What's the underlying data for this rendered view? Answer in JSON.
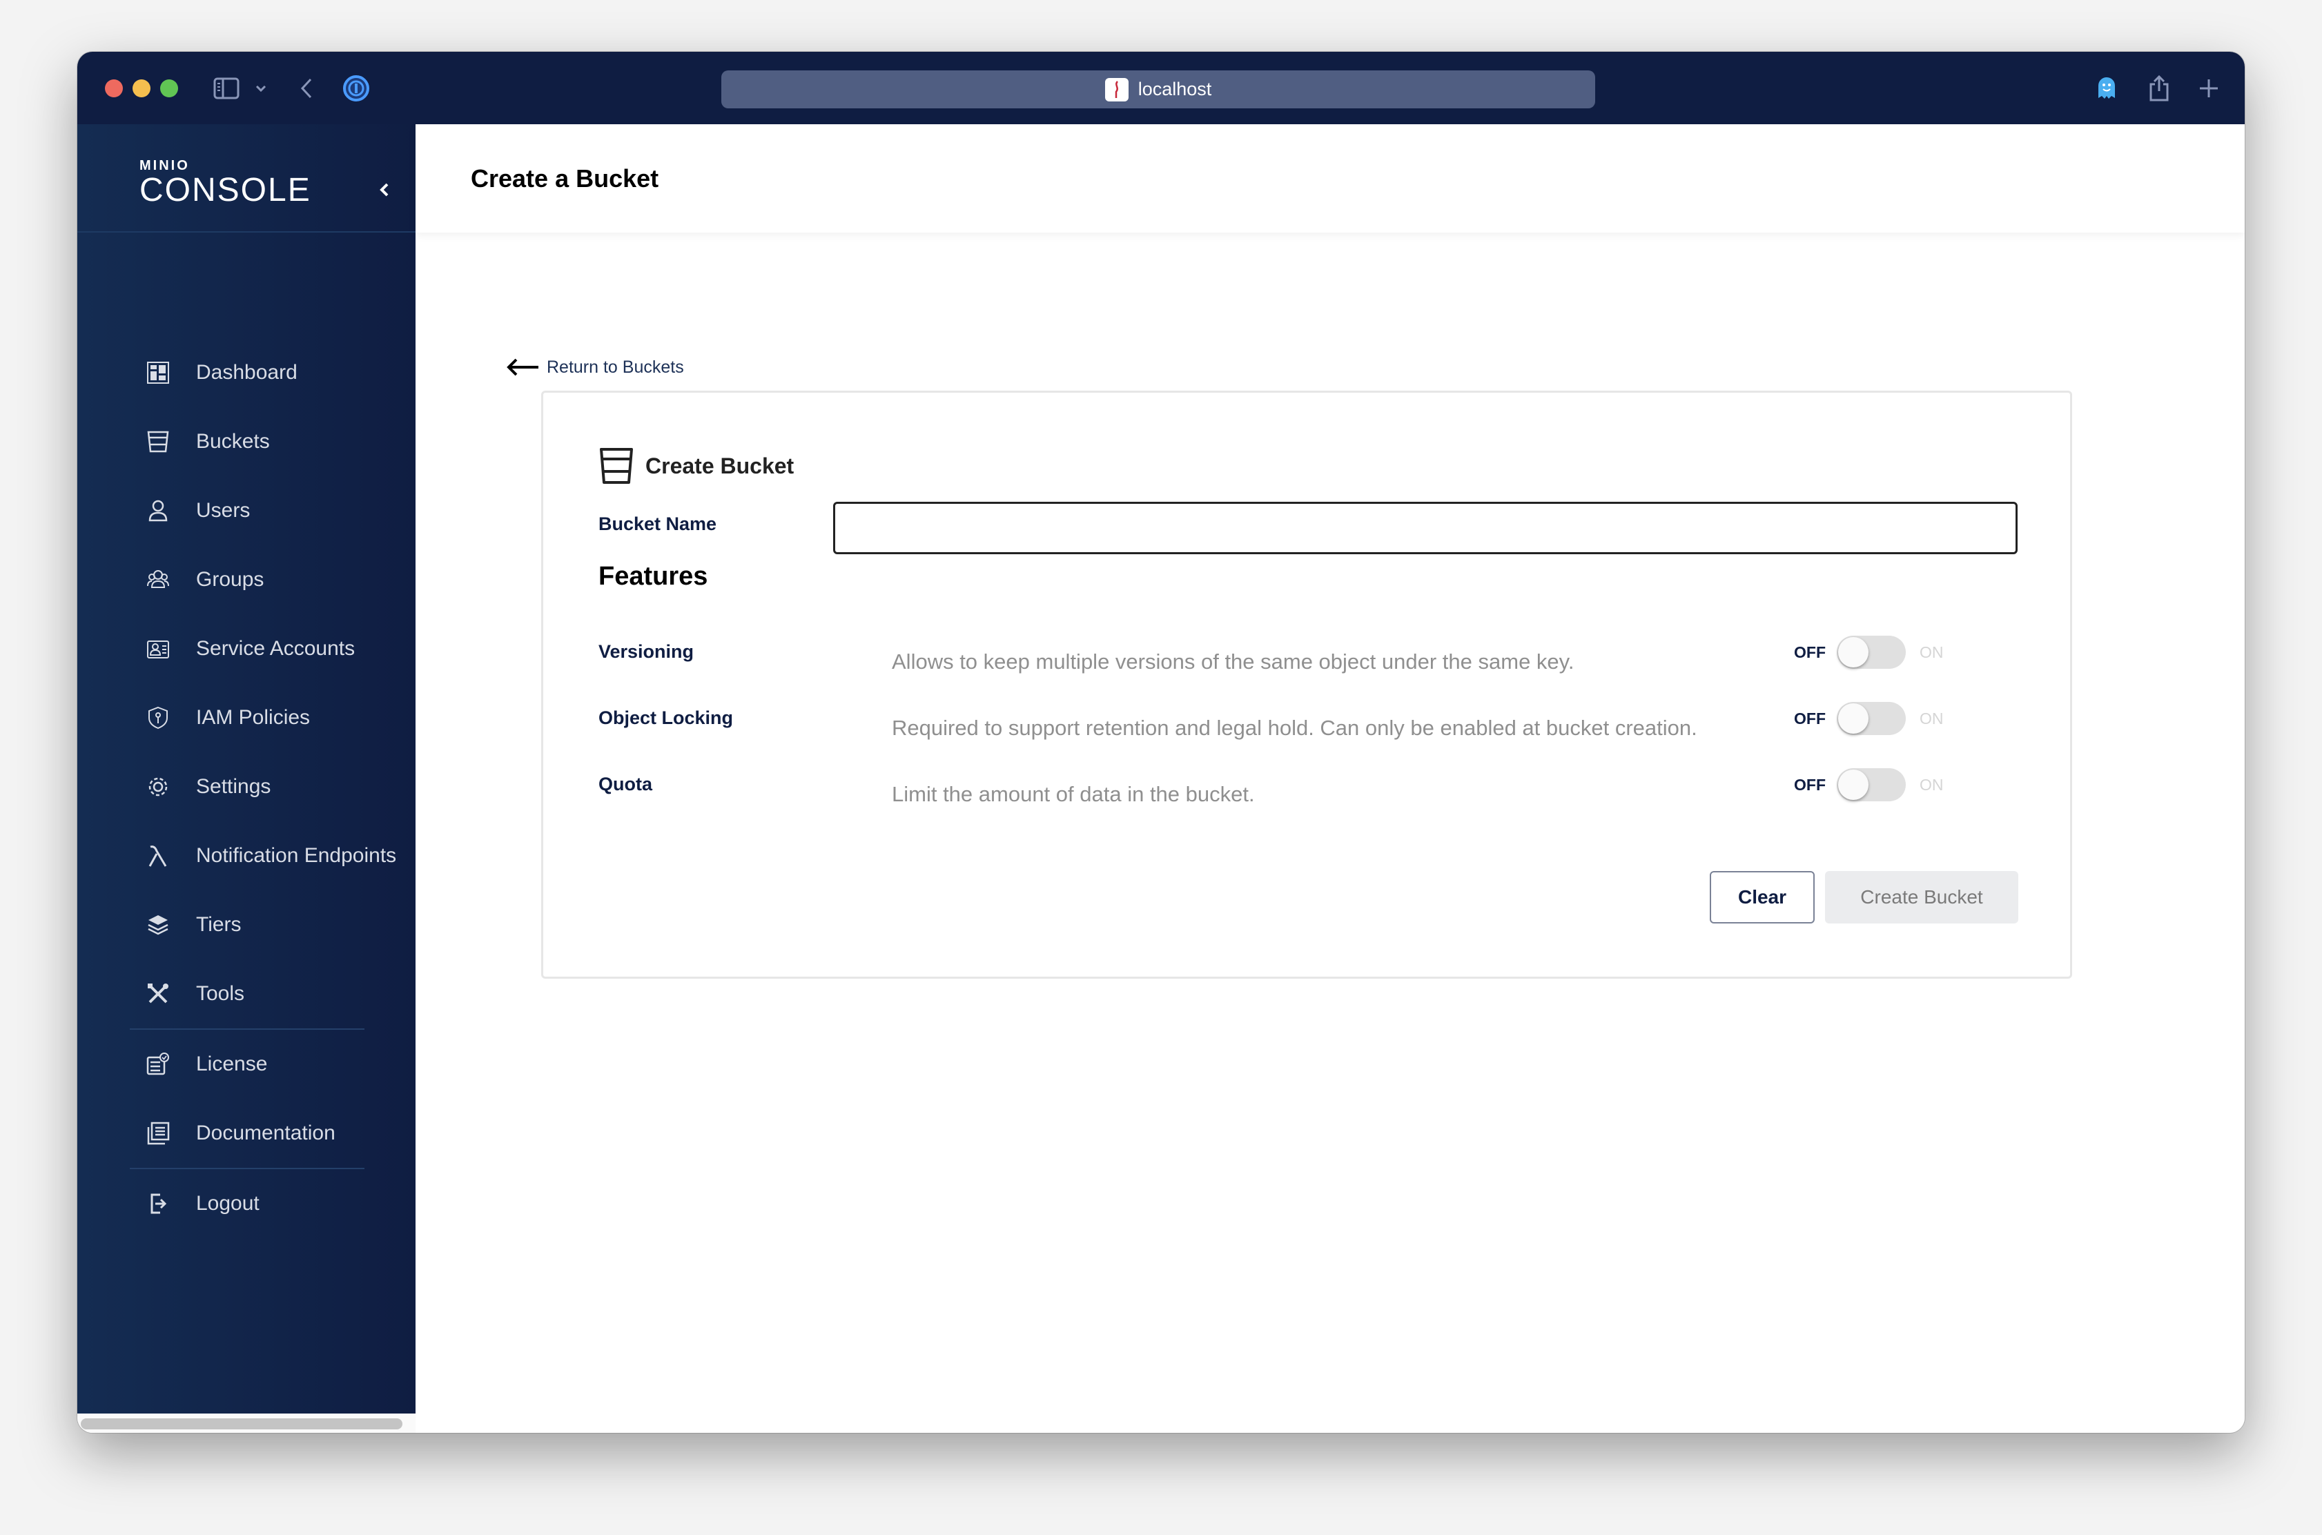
{
  "browser": {
    "url": "localhost",
    "icons": [
      "sidebar-toggle-icon",
      "chevron-down-icon",
      "back-icon",
      "password-manager-icon",
      "ghostery-icon",
      "share-icon",
      "new-tab-icon"
    ]
  },
  "app": {
    "logo_small": "MINIO",
    "logo_big": "CONSOLE"
  },
  "sidebar": {
    "items": [
      {
        "label": "Dashboard",
        "icon": "dashboard-icon"
      },
      {
        "label": "Buckets",
        "icon": "bucket-icon"
      },
      {
        "label": "Users",
        "icon": "user-icon"
      },
      {
        "label": "Groups",
        "icon": "groups-icon"
      },
      {
        "label": "Service Accounts",
        "icon": "service-accounts-icon"
      },
      {
        "label": "IAM Policies",
        "icon": "shield-icon"
      },
      {
        "label": "Settings",
        "icon": "gear-icon"
      },
      {
        "label": "Notification Endpoints",
        "icon": "lambda-icon"
      },
      {
        "label": "Tiers",
        "icon": "layers-icon"
      },
      {
        "label": "Tools",
        "icon": "tools-icon"
      },
      {
        "label": "License",
        "icon": "license-icon"
      },
      {
        "label": "Documentation",
        "icon": "documentation-icon"
      },
      {
        "label": "Logout",
        "icon": "logout-icon"
      }
    ]
  },
  "page": {
    "title": "Create a Bucket",
    "back_link": "Return to Buckets"
  },
  "form": {
    "title": "Create Bucket",
    "bucket_name_label": "Bucket Name",
    "bucket_name_value": "",
    "features_title": "Features",
    "features": [
      {
        "name": "Versioning",
        "description": "Allows to keep multiple versions of the same object under the same key.",
        "off_label": "OFF",
        "on_label": "ON",
        "enabled": false
      },
      {
        "name": "Object Locking",
        "description": "Required to support retention and legal hold. Can only be enabled at bucket creation.",
        "off_label": "OFF",
        "on_label": "ON",
        "enabled": false
      },
      {
        "name": "Quota",
        "description": "Limit the amount of data in the bucket.",
        "off_label": "OFF",
        "on_label": "ON",
        "enabled": false
      }
    ],
    "clear_label": "Clear",
    "create_label": "Create Bucket"
  }
}
